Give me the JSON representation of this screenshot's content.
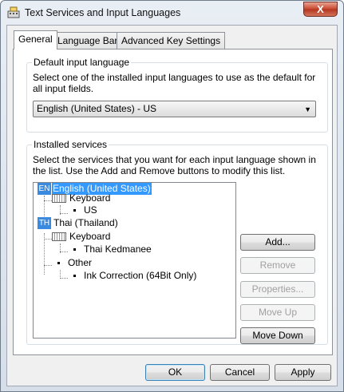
{
  "window": {
    "title": "Text Services and Input Languages",
    "close_label": "X"
  },
  "tabs": [
    {
      "label": "General"
    },
    {
      "label": "Language Bar"
    },
    {
      "label": "Advanced Key Settings"
    }
  ],
  "default_input": {
    "group_title": "Default input language",
    "description": "Select one of the installed input languages to use as the default for all input fields.",
    "selected": "English (United States) - US"
  },
  "installed_services": {
    "group_title": "Installed services",
    "description": "Select the services that you want for each input language shown in the list. Use the Add and Remove buttons to modify this list.",
    "tree": {
      "lang1_code": "EN",
      "lang1_name": "English (United States)",
      "lang1_keyboard": "Keyboard",
      "lang1_layout": "US",
      "lang2_code": "TH",
      "lang2_name": "Thai (Thailand)",
      "lang2_keyboard": "Keyboard",
      "lang2_layout": "Thai Kedmanee",
      "other": "Other",
      "other_item": "Ink Correction (64Bit Only)"
    }
  },
  "side_buttons": {
    "add": "Add...",
    "remove": "Remove",
    "properties": "Properties...",
    "move_up": "Move Up",
    "move_down": "Move Down"
  },
  "footer": {
    "ok": "OK",
    "cancel": "Cancel",
    "apply": "Apply"
  }
}
